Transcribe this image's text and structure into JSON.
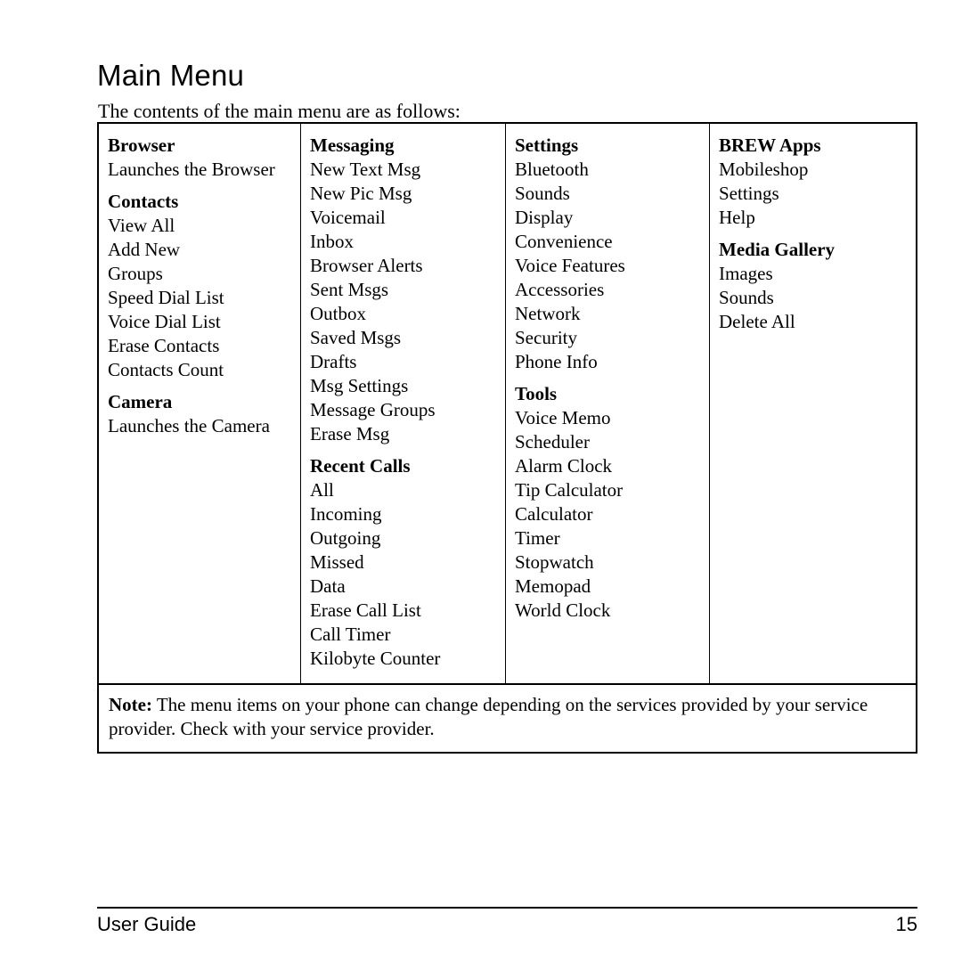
{
  "document": {
    "title": "Main Menu",
    "intro": "The contents of the main menu are as follows:"
  },
  "menu_table": {
    "columns": [
      {
        "id": "column-1",
        "sections": [
          {
            "heading": "Browser",
            "items": [
              "Launches the Browser"
            ]
          },
          {
            "heading": "Contacts",
            "items": [
              "View All",
              "Add New",
              "Groups",
              "Speed Dial List",
              "Voice Dial List",
              "Erase Contacts",
              "Contacts Count"
            ]
          },
          {
            "heading": "Camera",
            "items": [
              "Launches the Camera"
            ]
          }
        ]
      },
      {
        "id": "column-2",
        "sections": [
          {
            "heading": "Messaging",
            "items": [
              "New Text Msg",
              "New Pic Msg",
              "Voicemail",
              "Inbox",
              "Browser Alerts",
              "Sent Msgs",
              "Outbox",
              "Saved Msgs",
              "Drafts",
              "Msg Settings",
              "Message Groups",
              "Erase Msg"
            ]
          },
          {
            "heading": "Recent Calls",
            "items": [
              "All",
              "Incoming",
              "Outgoing",
              "Missed",
              "Data",
              "Erase Call List",
              "Call Timer",
              "Kilobyte Counter"
            ]
          }
        ]
      },
      {
        "id": "column-3",
        "sections": [
          {
            "heading": "Settings",
            "items": [
              "Bluetooth",
              "Sounds",
              "Display",
              "Convenience",
              "Voice Features",
              "Accessories",
              "Network",
              "Security",
              "Phone Info"
            ]
          },
          {
            "heading": "Tools",
            "items": [
              "Voice Memo",
              "Scheduler",
              "Alarm Clock",
              "Tip Calculator",
              "Calculator",
              "Timer",
              "Stopwatch",
              "Memopad",
              "World Clock"
            ]
          }
        ]
      },
      {
        "id": "column-4",
        "sections": [
          {
            "heading": "BREW Apps",
            "items": [
              "Mobileshop",
              "Settings",
              "Help"
            ]
          },
          {
            "heading": "Media Gallery",
            "items": [
              "Images",
              "Sounds",
              "Delete All"
            ]
          }
        ]
      }
    ],
    "note": {
      "label": "Note:",
      "text": " The menu items on your phone can change depending on the services provided by your service provider. Check with your service provider."
    }
  },
  "footer": {
    "left": "User Guide",
    "page_number": "15"
  },
  "colors": {
    "text": "#000000",
    "background": "#ffffff",
    "border": "#000000"
  }
}
